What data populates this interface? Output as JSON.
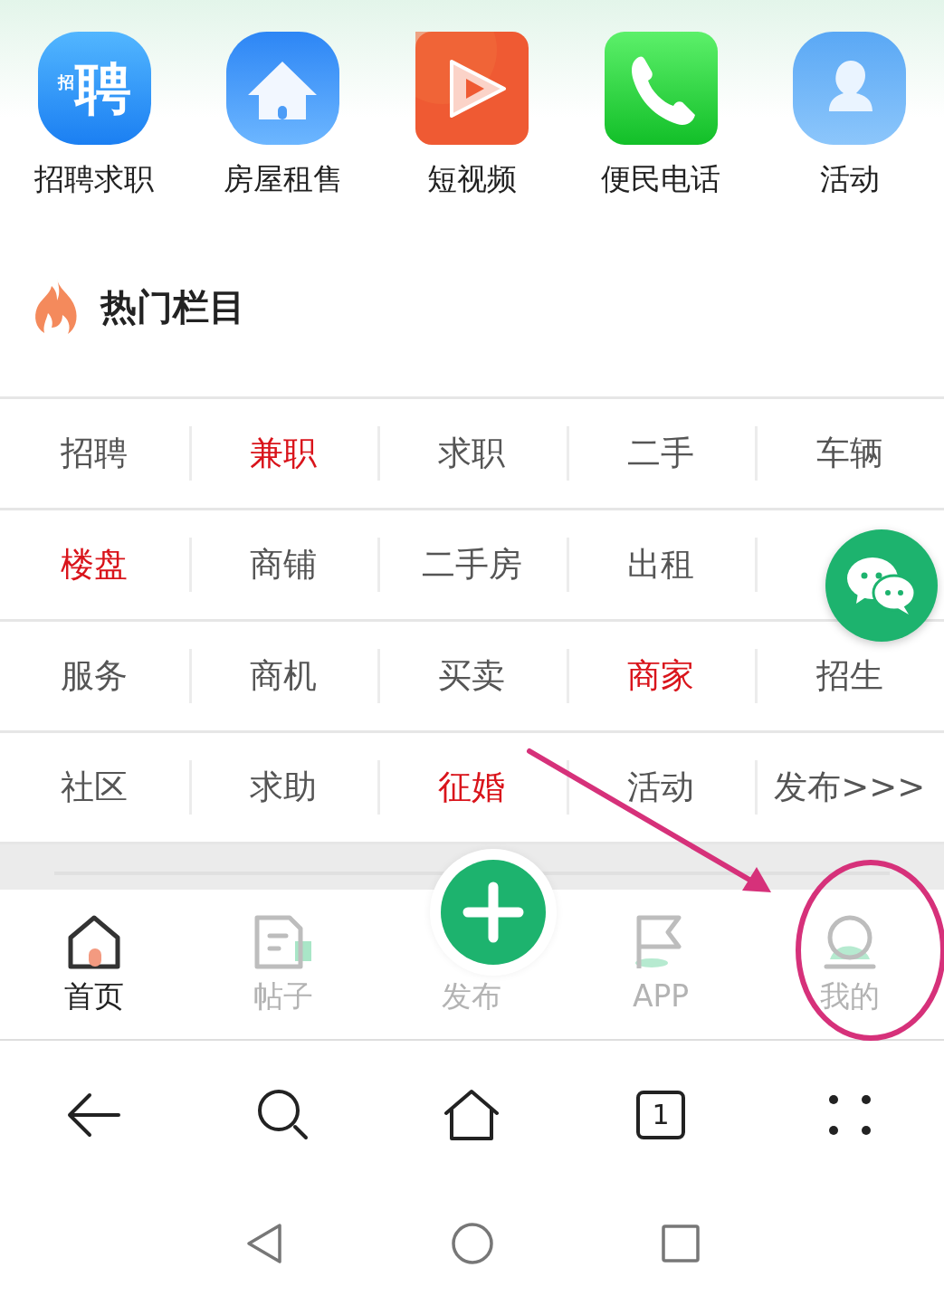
{
  "shortcuts": [
    {
      "label": "招聘求职",
      "kind": "hire",
      "glyph": "聘",
      "glyph_small": "招"
    },
    {
      "label": "房屋租售",
      "kind": "house"
    },
    {
      "label": "短视频",
      "kind": "video"
    },
    {
      "label": "便民电话",
      "kind": "phone"
    },
    {
      "label": "活动",
      "kind": "people"
    }
  ],
  "hot_section": {
    "title": "热门栏目"
  },
  "categories": [
    [
      {
        "label": "招聘",
        "highlight": false
      },
      {
        "label": "兼职",
        "highlight": true
      },
      {
        "label": "求职",
        "highlight": false
      },
      {
        "label": "二手",
        "highlight": false
      },
      {
        "label": "车辆",
        "highlight": false
      }
    ],
    [
      {
        "label": "楼盘",
        "highlight": true
      },
      {
        "label": "商铺",
        "highlight": false
      },
      {
        "label": "二手房",
        "highlight": false
      },
      {
        "label": "出租",
        "highlight": false
      }
    ],
    [
      {
        "label": "服务",
        "highlight": false
      },
      {
        "label": "商机",
        "highlight": false
      },
      {
        "label": "买卖",
        "highlight": false
      },
      {
        "label": "商家",
        "highlight": true
      },
      {
        "label": "招生",
        "highlight": false
      }
    ],
    [
      {
        "label": "社区",
        "highlight": false
      },
      {
        "label": "求助",
        "highlight": false
      },
      {
        "label": "征婚",
        "highlight": true
      },
      {
        "label": "活动",
        "highlight": false
      },
      {
        "label": "发布>>>",
        "highlight": false
      }
    ]
  ],
  "bottom_nav": [
    {
      "label": "首页",
      "kind": "home",
      "selected": true
    },
    {
      "label": "帖子",
      "kind": "doc",
      "selected": false
    },
    {
      "label": "发布",
      "kind": "plus",
      "selected": false
    },
    {
      "label": "APP",
      "kind": "flag",
      "selected": false
    },
    {
      "label": "我的",
      "kind": "user",
      "selected": false
    }
  ],
  "browser_toolbar": {
    "tab_count": "1"
  }
}
